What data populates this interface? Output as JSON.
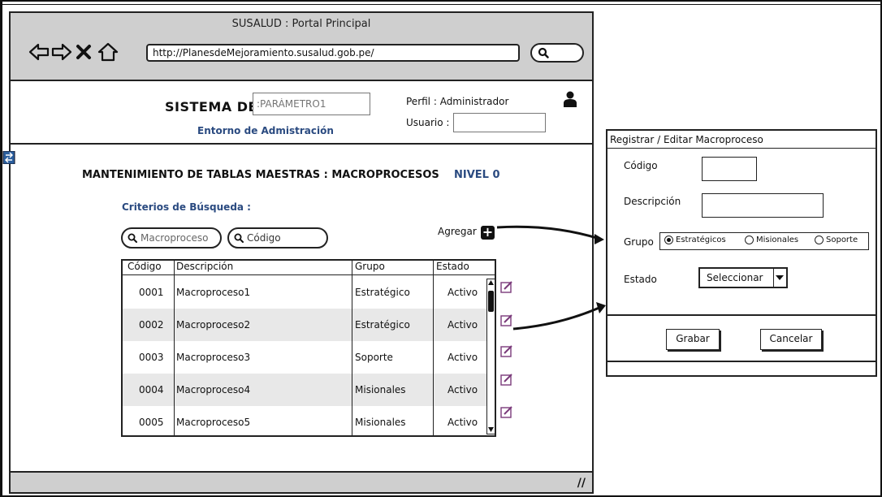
{
  "browser": {
    "title": "SUSALUD : Portal Principal",
    "url": "http://PlanesdeMejoramiento.susalud.gob.pe/"
  },
  "header": {
    "system_label": "SISTEMA DE",
    "param_placeholder": ":PARÁMETRO1",
    "environment": "Entorno de Admistración",
    "perfil": "Perfil : Administrador",
    "usuario_label": "Usuario :"
  },
  "main": {
    "title": "MANTENIMIENTO DE TABLAS MAESTRAS : MACROPROCESOS",
    "level": "NIVEL 0",
    "criteria_label": "Criterios de Búsqueda :",
    "search_macroproceso_placeholder": "Macroproceso",
    "search_codigo_placeholder": "Código",
    "add_label": "Agregar"
  },
  "table": {
    "headers": [
      "Código",
      "Descripción",
      "Grupo",
      "Estado"
    ],
    "rows": [
      {
        "codigo": "0001",
        "descripcion": "Macroproceso1",
        "grupo": "Estratégico",
        "estado": "Activo"
      },
      {
        "codigo": "0002",
        "descripcion": "Macroproceso2",
        "grupo": "Estratégico",
        "estado": "Activo"
      },
      {
        "codigo": "0003",
        "descripcion": "Macroproceso3",
        "grupo": "Soporte",
        "estado": "Activo"
      },
      {
        "codigo": "0004",
        "descripcion": "Macroproceso4",
        "grupo": "Misionales",
        "estado": "Activo"
      },
      {
        "codigo": "0005",
        "descripcion": "Macroproceso5",
        "grupo": "Misionales",
        "estado": "Activo"
      }
    ]
  },
  "dialog": {
    "title": "Registrar / Editar Macroproceso",
    "codigo_label": "Código",
    "descripcion_label": "Descripción",
    "grupo_label": "Grupo",
    "grupo_options": [
      "Estratégicos",
      "Misionales",
      "Soporte"
    ],
    "grupo_selected": "Estratégicos",
    "estado_label": "Estado",
    "estado_value": "Seleccionar",
    "save_label": "Grabar",
    "cancel_label": "Cancelar"
  },
  "colors": {
    "accent_blue": "#2a4a80",
    "chrome_gray": "#cfcfcf",
    "row_alt": "#e8e8e8",
    "edit_icon": "#7a3a7a"
  }
}
